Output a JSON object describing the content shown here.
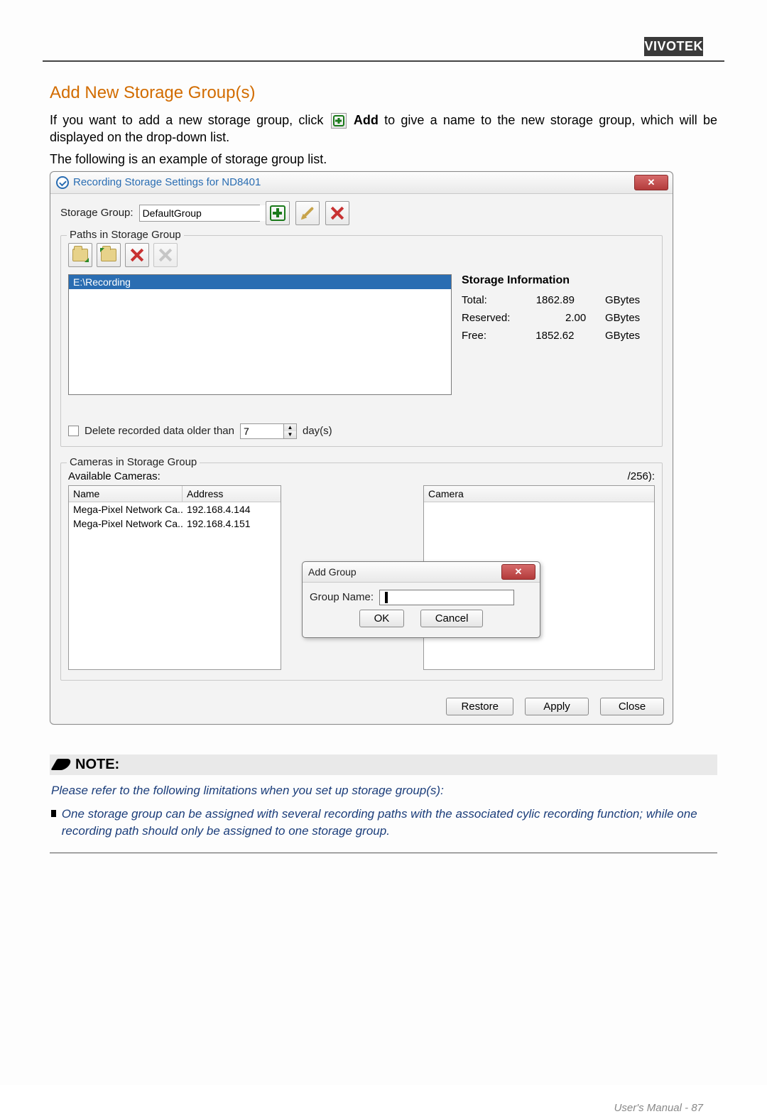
{
  "brand": "VIVOTEK",
  "section_title": "Add New Storage Group(s)",
  "intro_before": "If you want to add a new storage group, click ",
  "intro_add": "Add",
  "intro_after": " to give a name to the new storage group, which will be displayed on the drop-down list.",
  "example_line": "The following is an example of storage group list.",
  "dialog": {
    "title": "Recording Storage Settings for ND8401",
    "storage_group_label": "Storage Group:",
    "storage_group_value": "DefaultGroup",
    "paths_legend": "Paths in Storage Group",
    "path_selected": "E:\\Recording",
    "storage_info": {
      "title": "Storage Information",
      "rows": [
        {
          "label": "Total:",
          "value": "1862.89",
          "unit": "GBytes"
        },
        {
          "label": "Reserved:",
          "value": "2.00",
          "unit": "GBytes"
        },
        {
          "label": "Free:",
          "value": "1852.62",
          "unit": "GBytes"
        }
      ]
    },
    "delete_label": "Delete recorded data older than",
    "delete_value": "7",
    "delete_unit": "day(s)",
    "cameras_legend": "Cameras in Storage Group",
    "available_label": "Available Cameras:",
    "col_name": "Name",
    "col_address": "Address",
    "cameras": [
      {
        "name": "Mega-Pixel Network Ca...",
        "addr": "192.168.4.144"
      },
      {
        "name": "Mega-Pixel Network Ca...",
        "addr": "192.168.4.151"
      }
    ],
    "sel_count_suffix": "/256):",
    "sel_col": "Camera",
    "arrow_label": "->",
    "restore": "Restore",
    "apply": "Apply",
    "close": "Close"
  },
  "add_group": {
    "title": "Add Group",
    "label": "Group Name:",
    "value": "",
    "ok": "OK",
    "cancel": "Cancel"
  },
  "note": {
    "heading": "NOTE:",
    "line1": "Please refer to the following limitations when you set up storage group(s):",
    "bullet": "One storage group can be assigned with several recording paths with the associated cylic recording function; while one recording path should only be assigned to one storage group."
  },
  "footer": {
    "label": "User's Manual - ",
    "page": "87"
  }
}
